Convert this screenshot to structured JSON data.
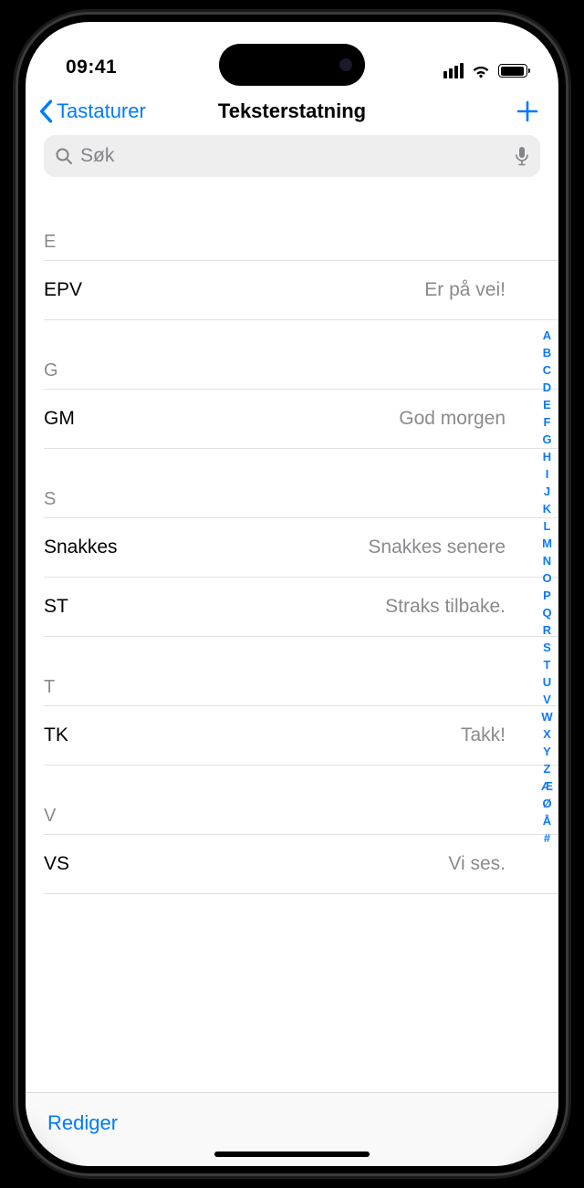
{
  "status": {
    "time": "09:41"
  },
  "nav": {
    "back": "Tastaturer",
    "title": "Teksterstatning"
  },
  "search": {
    "placeholder": "Søk"
  },
  "sections": [
    {
      "letter": "E",
      "rows": [
        {
          "shortcut": "EPV",
          "phrase": "Er på vei!"
        }
      ]
    },
    {
      "letter": "G",
      "rows": [
        {
          "shortcut": "GM",
          "phrase": "God morgen"
        }
      ]
    },
    {
      "letter": "S",
      "rows": [
        {
          "shortcut": "Snakkes",
          "phrase": "Snakkes senere"
        },
        {
          "shortcut": "ST",
          "phrase": "Straks tilbake."
        }
      ]
    },
    {
      "letter": "T",
      "rows": [
        {
          "shortcut": "TK",
          "phrase": "Takk!"
        }
      ]
    },
    {
      "letter": "V",
      "rows": [
        {
          "shortcut": "VS",
          "phrase": "Vi ses."
        }
      ]
    }
  ],
  "index_letters": [
    "A",
    "B",
    "C",
    "D",
    "E",
    "F",
    "G",
    "H",
    "I",
    "J",
    "K",
    "L",
    "M",
    "N",
    "O",
    "P",
    "Q",
    "R",
    "S",
    "T",
    "U",
    "V",
    "W",
    "X",
    "Y",
    "Z",
    "Æ",
    "Ø",
    "Å",
    "#"
  ],
  "toolbar": {
    "edit": "Rediger"
  }
}
